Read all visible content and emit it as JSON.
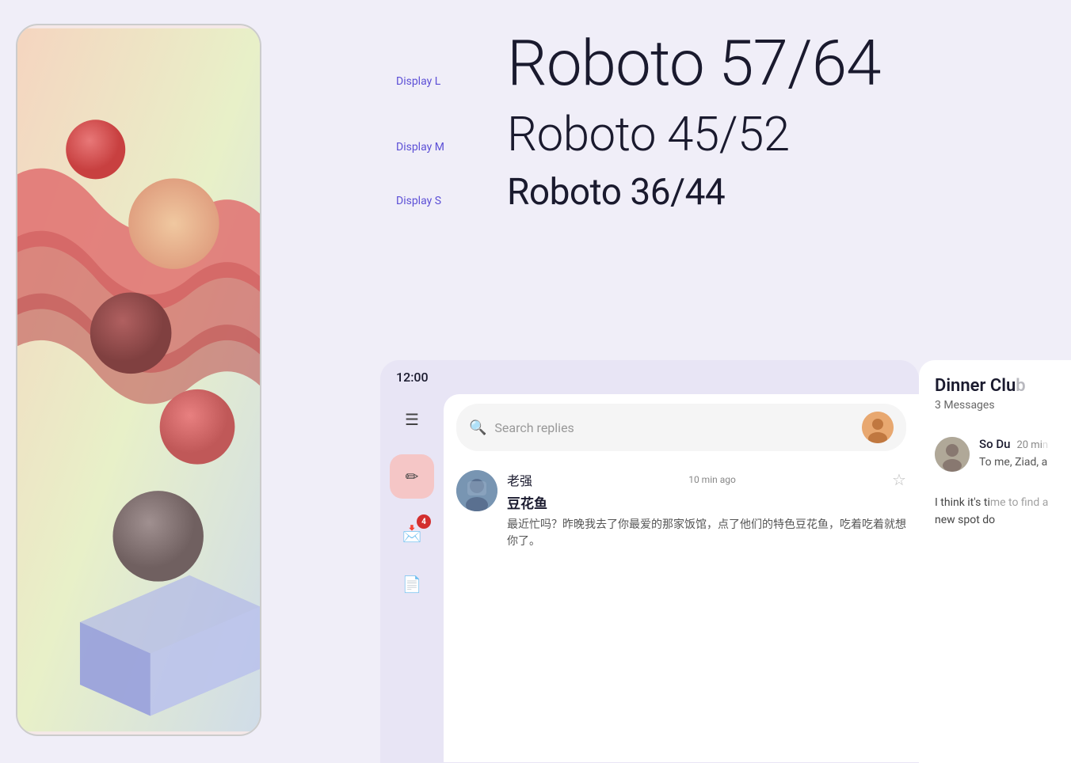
{
  "page": {
    "background_color": "#f0eef8"
  },
  "phone_art": {
    "alt": "Abstract 3D art with colorful shapes and waves"
  },
  "type_scale": {
    "rows": [
      {
        "label": "Display L",
        "text": "Roboto 57/64",
        "size_class": "type-display-l"
      },
      {
        "label": "Display M",
        "text": "Roboto 45/52",
        "size_class": "type-display-m"
      },
      {
        "label": "Display S",
        "text": "Roboto 36/44",
        "size_class": "type-display-s"
      }
    ]
  },
  "ui_mockup": {
    "status_bar": {
      "time": "12:00"
    },
    "search": {
      "placeholder": "Search replies"
    },
    "sidebar": {
      "icons": [
        {
          "name": "menu-icon",
          "symbol": "☰"
        },
        {
          "name": "compose-icon",
          "symbol": "✏",
          "style": "compose"
        },
        {
          "name": "inbox-icon",
          "symbol": "📩",
          "badge": "4"
        },
        {
          "name": "document-icon",
          "symbol": "📄"
        }
      ]
    },
    "messages": [
      {
        "sender": "老强",
        "time": "10 min ago",
        "subject": "豆花鱼",
        "preview": "最近忙吗？昨晚我去了你最爱的那家饭馆，点了他们的特色豆花鱼，吃着吃着就想你了。",
        "avatar_color": "#7895b2"
      }
    ],
    "right_panel": {
      "title": "Dinner Club",
      "subtitle": "3 Messages",
      "messages": [
        {
          "sender": "So Du",
          "time": "20 min",
          "preview": "To me, Ziad, a",
          "avatar_color": "#c0b0a0"
        }
      ],
      "footer_preview": "I think it's time to find a new spot do"
    }
  }
}
